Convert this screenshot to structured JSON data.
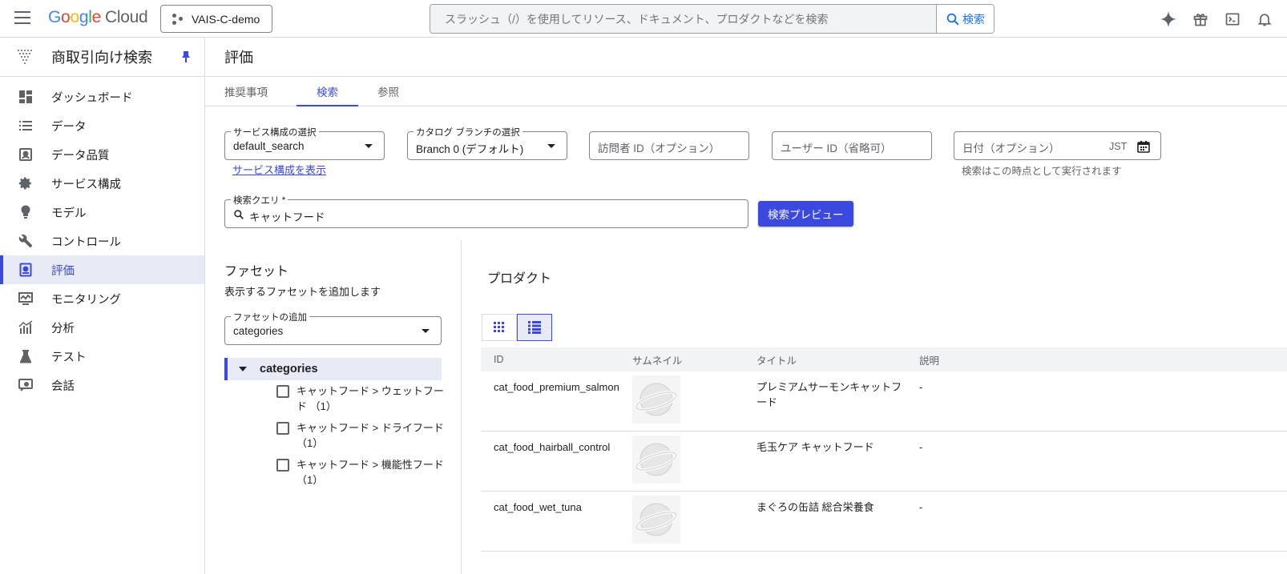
{
  "header": {
    "logo_google": "Google",
    "logo_cloud": "Cloud",
    "project": "VAIS-C-demo",
    "search_placeholder": "スラッシュ（/）を使用してリソース、ドキュメント、プロダクトなどを検索",
    "search_button": "検索"
  },
  "sidebar": {
    "title": "商取引向け検索",
    "items": [
      {
        "label": "ダッシュボード",
        "icon": "dashboard-icon"
      },
      {
        "label": "データ",
        "icon": "list-icon"
      },
      {
        "label": "データ品質",
        "icon": "data-quality-icon"
      },
      {
        "label": "サービス構成",
        "icon": "gear-icon"
      },
      {
        "label": "モデル",
        "icon": "lightbulb-icon"
      },
      {
        "label": "コントロール",
        "icon": "wrench-icon"
      },
      {
        "label": "評価",
        "icon": "evaluation-icon",
        "active": true
      },
      {
        "label": "モニタリング",
        "icon": "monitoring-icon"
      },
      {
        "label": "分析",
        "icon": "analytics-icon"
      },
      {
        "label": "テスト",
        "icon": "flask-icon"
      },
      {
        "label": "会話",
        "icon": "conversation-icon"
      }
    ]
  },
  "page": {
    "title": "評価",
    "tabs": [
      "推奨事項",
      "検索",
      "参照"
    ],
    "active_tab": 1
  },
  "form": {
    "serving_config_label": "サービス構成の選択",
    "serving_config_value": "default_search",
    "serving_config_link": "サービス構成を表示",
    "branch_label": "カタログ ブランチの選択",
    "branch_value": "Branch 0 (デフォルト)",
    "visitor_placeholder": "訪問者 ID（オプション）",
    "user_placeholder": "ユーザー ID（省略可）",
    "date_placeholder": "日付（オプション）",
    "date_tz": "JST",
    "date_helper": "検索はこの時点として実行されます",
    "query_label": "検索クエリ *",
    "query_value": "キャットフード",
    "preview_button": "検索プレビュー"
  },
  "facets": {
    "title": "ファセット",
    "subtitle": "表示するファセットを追加します",
    "add_label": "ファセットの追加",
    "add_value": "categories",
    "group": "categories",
    "options": [
      "キャットフード > ウェットフード （1）",
      "キャットフード > ドライフード （1）",
      "キャットフード > 機能性フード （1）"
    ]
  },
  "products": {
    "title": "プロダクト",
    "columns": [
      "ID",
      "サムネイル",
      "タイトル",
      "説明"
    ],
    "rows": [
      {
        "id": "cat_food_premium_salmon",
        "title": "プレミアムサーモンキャットフード",
        "desc": "-"
      },
      {
        "id": "cat_food_hairball_control",
        "title": "毛玉ケア キャットフード",
        "desc": "-"
      },
      {
        "id": "cat_food_wet_tuna",
        "title": "まぐろの缶詰 総合栄養食",
        "desc": "-"
      }
    ]
  },
  "colors": {
    "accent": "#3b49df",
    "active_bg": "#e8eaf6"
  }
}
